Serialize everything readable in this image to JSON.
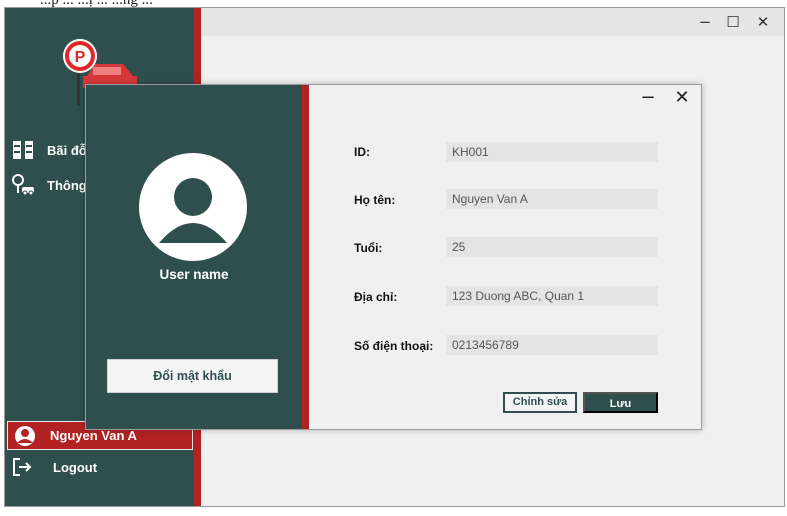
{
  "top_caption": "...p ... ...ị ... ...ng ...",
  "window": {
    "minimize": "−",
    "maximize": "☐",
    "close": "✕"
  },
  "sidebar": {
    "items": [
      {
        "label": "Bãi đỗ",
        "icon": "parking-lots-icon"
      },
      {
        "label": "Thông tin",
        "icon": "car-location-icon"
      }
    ],
    "user": {
      "name": "Nguyen Van A",
      "icon": "user-avatar-icon"
    },
    "logout": {
      "label": "Logout",
      "icon": "logout-icon"
    }
  },
  "dialog": {
    "minimize": "−",
    "close": "✕",
    "username": "User name",
    "change_password": "Đổi mật khẩu",
    "fields": [
      {
        "label": "ID:",
        "value": "KH001"
      },
      {
        "label": "Họ tên:",
        "value": "Nguyen Van A"
      },
      {
        "label": "Tuổi:",
        "value": "25"
      },
      {
        "label": "Địa chỉ:",
        "value": "123 Duong ABC, Quan 1"
      },
      {
        "label": "Số điện thoại:",
        "value": "0213456789"
      }
    ],
    "edit_label": "Chỉnh sửa",
    "save_label": "Lưu"
  },
  "colors": {
    "sidebar": "#2f4f4f",
    "accent": "#b22222",
    "background": "#f0f0f0"
  }
}
